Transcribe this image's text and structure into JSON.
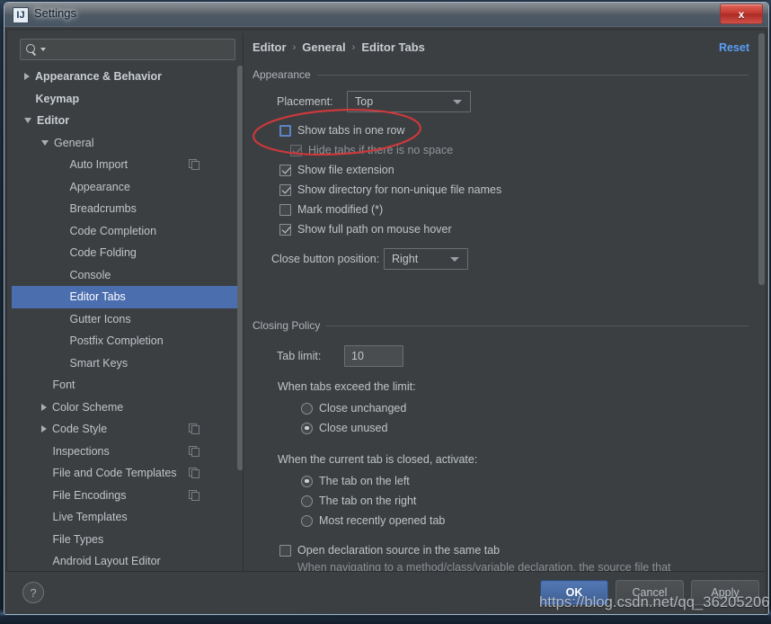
{
  "window": {
    "title": "Settings",
    "app_icon": "intellij-idea-icon",
    "close_label": "x"
  },
  "search": {
    "value": "",
    "placeholder": ""
  },
  "sidebar": {
    "items": [
      {
        "label": "Appearance & Behavior",
        "indent": 0,
        "arrow": "collapsed",
        "bold": true,
        "selected": false,
        "module_icon": false
      },
      {
        "label": "Keymap",
        "indent": 0,
        "arrow": "none",
        "bold": true,
        "selected": false,
        "module_icon": false
      },
      {
        "label": "Editor",
        "indent": 0,
        "arrow": "expanded",
        "bold": true,
        "selected": false,
        "module_icon": false
      },
      {
        "label": "General",
        "indent": 1,
        "arrow": "expanded",
        "bold": false,
        "selected": false,
        "module_icon": false
      },
      {
        "label": "Auto Import",
        "indent": 2,
        "arrow": "none",
        "bold": false,
        "selected": false,
        "module_icon": true
      },
      {
        "label": "Appearance",
        "indent": 2,
        "arrow": "none",
        "bold": false,
        "selected": false,
        "module_icon": false
      },
      {
        "label": "Breadcrumbs",
        "indent": 2,
        "arrow": "none",
        "bold": false,
        "selected": false,
        "module_icon": false
      },
      {
        "label": "Code Completion",
        "indent": 2,
        "arrow": "none",
        "bold": false,
        "selected": false,
        "module_icon": false
      },
      {
        "label": "Code Folding",
        "indent": 2,
        "arrow": "none",
        "bold": false,
        "selected": false,
        "module_icon": false
      },
      {
        "label": "Console",
        "indent": 2,
        "arrow": "none",
        "bold": false,
        "selected": false,
        "module_icon": false
      },
      {
        "label": "Editor Tabs",
        "indent": 2,
        "arrow": "none",
        "bold": false,
        "selected": true,
        "module_icon": false
      },
      {
        "label": "Gutter Icons",
        "indent": 2,
        "arrow": "none",
        "bold": false,
        "selected": false,
        "module_icon": false
      },
      {
        "label": "Postfix Completion",
        "indent": 2,
        "arrow": "none",
        "bold": false,
        "selected": false,
        "module_icon": false
      },
      {
        "label": "Smart Keys",
        "indent": 2,
        "arrow": "none",
        "bold": false,
        "selected": false,
        "module_icon": false
      },
      {
        "label": "Font",
        "indent": 1,
        "arrow": "none",
        "bold": false,
        "selected": false,
        "module_icon": false
      },
      {
        "label": "Color Scheme",
        "indent": 1,
        "arrow": "collapsed",
        "bold": false,
        "selected": false,
        "module_icon": false
      },
      {
        "label": "Code Style",
        "indent": 1,
        "arrow": "collapsed",
        "bold": false,
        "selected": false,
        "module_icon": true
      },
      {
        "label": "Inspections",
        "indent": 1,
        "arrow": "none",
        "bold": false,
        "selected": false,
        "module_icon": true
      },
      {
        "label": "File and Code Templates",
        "indent": 1,
        "arrow": "none",
        "bold": false,
        "selected": false,
        "module_icon": true
      },
      {
        "label": "File Encodings",
        "indent": 1,
        "arrow": "none",
        "bold": false,
        "selected": false,
        "module_icon": true
      },
      {
        "label": "Live Templates",
        "indent": 1,
        "arrow": "none",
        "bold": false,
        "selected": false,
        "module_icon": false
      },
      {
        "label": "File Types",
        "indent": 1,
        "arrow": "none",
        "bold": false,
        "selected": false,
        "module_icon": false
      },
      {
        "label": "Android Layout Editor",
        "indent": 1,
        "arrow": "none",
        "bold": false,
        "selected": false,
        "module_icon": false
      }
    ]
  },
  "header": {
    "breadcrumb": [
      "Editor",
      "General",
      "Editor Tabs"
    ],
    "separator": "›",
    "reset_label": "Reset"
  },
  "appearance": {
    "group_title": "Appearance",
    "placement_label": "Placement:",
    "placement_value": "Top",
    "checkboxes": [
      {
        "label": "Show tabs in one row",
        "checked": false,
        "focused": true,
        "disabled": false
      },
      {
        "label": "Hide tabs if there is no space",
        "checked": true,
        "focused": false,
        "disabled": true
      },
      {
        "label": "Show file extension",
        "checked": true,
        "focused": false,
        "disabled": false
      },
      {
        "label": "Show directory for non-unique file names",
        "checked": true,
        "focused": false,
        "disabled": false
      },
      {
        "label": "Mark modified (*)",
        "checked": false,
        "focused": false,
        "disabled": false
      },
      {
        "label": "Show full path on mouse hover",
        "checked": true,
        "focused": false,
        "disabled": false
      }
    ],
    "close_button_label": "Close button position:",
    "close_button_value": "Right"
  },
  "closing_policy": {
    "group_title": "Closing Policy",
    "tab_limit_label": "Tab limit:",
    "tab_limit_value": "10",
    "exceed_label": "When tabs exceed the limit:",
    "exceed_options": [
      {
        "label": "Close unchanged",
        "checked": false
      },
      {
        "label": "Close unused",
        "checked": true
      }
    ],
    "activate_label": "When the current tab is closed, activate:",
    "activate_options": [
      {
        "label": "The tab on the left",
        "checked": true
      },
      {
        "label": "The tab on the right",
        "checked": false
      },
      {
        "label": "Most recently opened tab",
        "checked": false
      }
    ],
    "open_declaration_label": "Open declaration source in the same tab",
    "open_declaration_checked": false,
    "open_declaration_hint": "When navigating to a method/class/variable declaration, the source file that contains the declaration will replace the current tab if there are no changes."
  },
  "footer": {
    "help_label": "?",
    "ok_label": "OK",
    "cancel_label": "Cancel",
    "apply_label": "Apply"
  },
  "annotation": {
    "color": "#d0383c",
    "shape": "ellipse-highlight",
    "target": "Show tabs in one row"
  },
  "watermark": {
    "text": "https://blog.csdn.net/qq_36205206"
  },
  "colors": {
    "accent": "#4b6eaf",
    "link": "#589df6",
    "panel_bg": "#3c3f41",
    "text": "#bfc4c8",
    "annotation_red": "#d0383c"
  }
}
